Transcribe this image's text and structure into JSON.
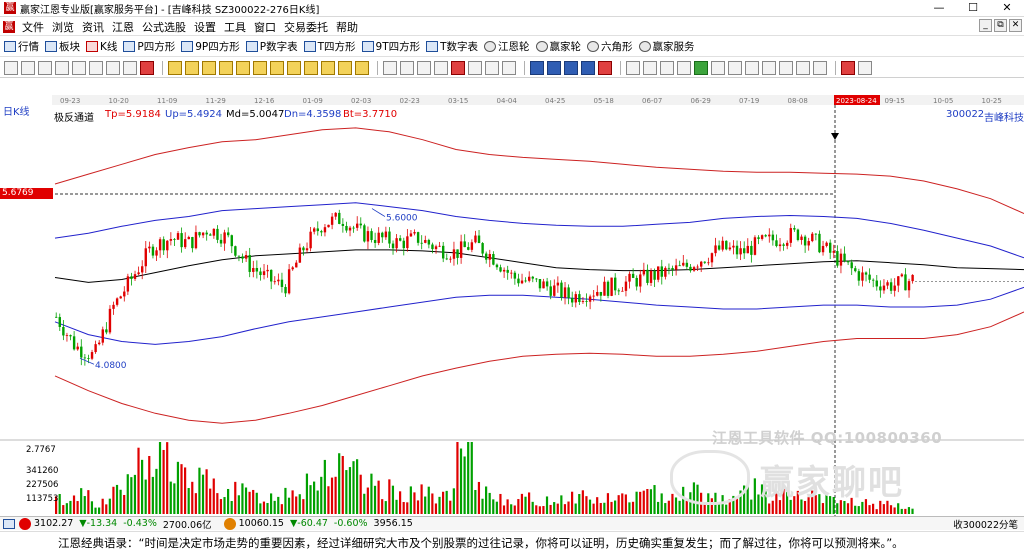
{
  "window": {
    "title": "赢家江恩专业版[赢家服务平台] - [吉峰科技  SZ300022-276日K线]",
    "logo_text": "赢",
    "min": "—",
    "max": "☐",
    "close": "✕"
  },
  "menu": [
    "文件",
    "浏览",
    "资讯",
    "江恩",
    "公式选股",
    "设置",
    "工具",
    "窗口",
    "交易委托",
    "帮助"
  ],
  "mdi_buttons": [
    "_",
    "⧉",
    "✕"
  ],
  "toolbar1": [
    {
      "label": "行情",
      "icon": "grid-icon"
    },
    {
      "label": "板块",
      "icon": "grid-icon"
    },
    {
      "label": "K线",
      "icon": "candle-icon"
    },
    {
      "label": "P四方形",
      "icon": "square-icon"
    },
    {
      "label": "9P四方形",
      "icon": "square-icon"
    },
    {
      "label": "P数字表",
      "icon": "table-icon"
    },
    {
      "label": "T四方形",
      "icon": "square-icon"
    },
    {
      "label": "9T四方形",
      "icon": "square-icon"
    },
    {
      "label": "T数字表",
      "icon": "table-icon"
    },
    {
      "label": "江恩轮",
      "icon": "wheel-icon"
    },
    {
      "label": "赢家轮",
      "icon": "wheel-icon"
    },
    {
      "label": "六角形",
      "icon": "hexagon-icon"
    },
    {
      "label": "赢家服务",
      "icon": "dollar-icon"
    }
  ],
  "chart": {
    "period_label": "日K线",
    "indicator_name": "极反通道",
    "tp": "Tp=5.9184",
    "up": "Up=5.4924",
    "md": "Md=5.0047",
    "dn": "Dn=4.3598",
    "bt": "Bt=3.7710",
    "stock_code": "300022",
    "stock_name": "吉峰科技",
    "crosshair_price": "5.6769",
    "crosshair_date": "2023-08-24",
    "high_label": "5.6000",
    "low_label": "4.0800",
    "date_ticks": [
      "09-23",
      "10-20",
      "11-09",
      "11-29",
      "12-16",
      "01-09",
      "02-03",
      "02-23",
      "03-15",
      "04-04",
      "04-25",
      "05-18",
      "06-07",
      "06-29",
      "07-19",
      "08-08",
      "2023-08-24",
      "09-15",
      "10-05",
      "10-25"
    ],
    "volume_ticks": [
      "2.7767",
      "341260",
      "227506",
      "113753"
    ],
    "colors": {
      "up_candle": "#e00000",
      "down_candle": "#00a000",
      "outer_band": "#cc2222",
      "inner_band": "#2222cc",
      "mid_line": "#000000"
    }
  },
  "chart_data": {
    "type": "candlestick",
    "title": "吉峰科技 300022 日K线",
    "indicator": "极反通道",
    "ylim": [
      2.7767,
      6.5
    ],
    "label_points": [
      {
        "label": "5.6000",
        "value": 5.6
      },
      {
        "label": "4.0800",
        "value": 4.08
      }
    ],
    "bands_last": {
      "Tp": 5.9184,
      "Up": 5.4924,
      "Md": 5.0047,
      "Dn": 4.3598,
      "Bt": 3.771
    },
    "tp_series": [
      5.85,
      5.95,
      6.05,
      6.15,
      6.22,
      6.28,
      6.3,
      6.35,
      6.4,
      6.42,
      6.38,
      6.3,
      6.2,
      6.15,
      6.12,
      6.1,
      6.08,
      6.05,
      6.02,
      6.0,
      5.98,
      5.97,
      5.97,
      5.96,
      5.95,
      5.93,
      5.88,
      5.8,
      5.7,
      5.55
    ],
    "up_series": [
      5.3,
      5.35,
      5.42,
      5.48,
      5.52,
      5.58,
      5.6,
      5.62,
      5.64,
      5.66,
      5.62,
      5.58,
      5.52,
      5.48,
      5.45,
      5.43,
      5.42,
      5.42,
      5.44,
      5.46,
      5.5,
      5.52,
      5.53,
      5.52,
      5.5,
      5.45,
      5.38,
      5.3,
      5.22,
      5.1
    ],
    "md_series": [
      4.9,
      4.85,
      4.88,
      4.95,
      5.02,
      5.08,
      5.12,
      5.14,
      5.16,
      5.18,
      5.18,
      5.17,
      5.15,
      5.1,
      5.05,
      5.0,
      4.98,
      4.97,
      4.97,
      4.98,
      5.0,
      5.02,
      5.04,
      5.06,
      5.07,
      5.05,
      5.03,
      5.0,
      4.99,
      4.98
    ],
    "dn_series": [
      4.45,
      4.32,
      4.25,
      4.22,
      4.25,
      4.3,
      4.38,
      4.45,
      4.5,
      4.55,
      4.6,
      4.65,
      4.7,
      4.72,
      4.72,
      4.7,
      4.68,
      4.65,
      4.62,
      4.6,
      4.58,
      4.58,
      4.6,
      4.62,
      4.62,
      4.6,
      4.6,
      4.62,
      4.68,
      4.8
    ],
    "bt_series": [
      3.9,
      3.75,
      3.62,
      3.52,
      3.45,
      3.42,
      3.45,
      3.52,
      3.6,
      3.7,
      3.8,
      3.9,
      3.98,
      4.05,
      4.1,
      4.12,
      4.13,
      4.12,
      4.1,
      4.1,
      4.12,
      4.15,
      4.2,
      4.25,
      4.28,
      4.28,
      4.28,
      4.32,
      4.4,
      4.55
    ],
    "closes": [
      4.5,
      4.2,
      4.1,
      4.6,
      4.9,
      5.2,
      5.3,
      5.25,
      5.4,
      5.3,
      5.05,
      4.9,
      4.8,
      5.2,
      5.45,
      5.5,
      5.35,
      5.3,
      5.25,
      5.3,
      5.2,
      5.15,
      5.25,
      5.1,
      4.9,
      4.85,
      4.8,
      4.7,
      4.75,
      4.8,
      4.85,
      4.9,
      4.95,
      5.0,
      5.1,
      5.2,
      5.15,
      5.25,
      5.3,
      5.35,
      5.25,
      5.1,
      4.95,
      4.85,
      4.82,
      4.88
    ],
    "volumes": [
      80000,
      120000,
      60000,
      150000,
      260000,
      340000,
      210000,
      180000,
      150000,
      120000,
      100000,
      90000,
      140000,
      200000,
      250000,
      220000,
      150000,
      130000,
      120000,
      110000,
      100000,
      340000,
      120000,
      90000,
      80000,
      70000,
      90000,
      100000,
      80000,
      90000,
      100000,
      110000,
      120000,
      130000,
      100000,
      90000,
      150000,
      110000,
      100000,
      90000,
      80000,
      70000,
      60000,
      50000,
      40000,
      30000
    ]
  },
  "status": {
    "sh_icon": "沪",
    "sh_index": "3102.27",
    "sh_change": "▼-13.34",
    "sh_pct": "-0.43%",
    "sh_amount": "2700.06亿",
    "sz_icon": "深",
    "sz_index": "10060.15",
    "sz_change": "▼-60.47",
    "sz_pct": "-0.60%",
    "sz_amount": "3956.15",
    "right_text": "收300022分笔"
  },
  "quote": "江恩经典语录：“时间是决定市场走势的重要因素，经过详细研究大市及个别股票的过往记录，你将可以证明，历史确实重复发生；而了解过往，你将可以预测将来。”。",
  "watermark": {
    "line1": "江恩工具软件   QQ:100800360",
    "line2": "赢家聊吧"
  }
}
